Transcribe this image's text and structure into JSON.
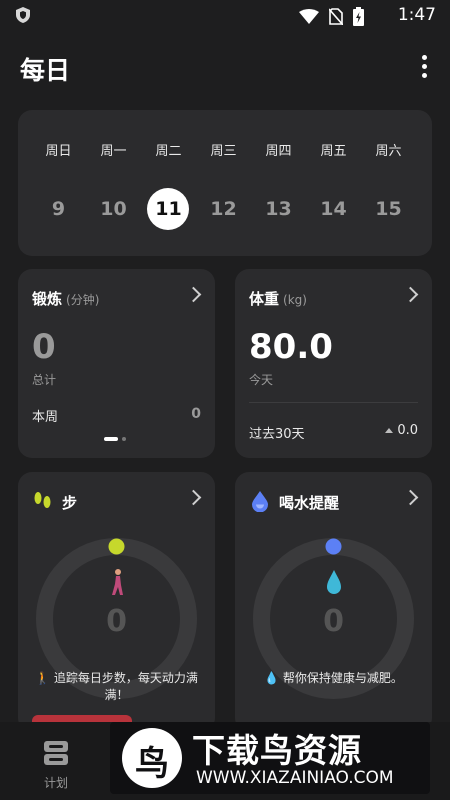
{
  "status_bar": {
    "time": "1:47"
  },
  "app": {
    "title": "每日"
  },
  "week": {
    "names": [
      "周日",
      "周一",
      "周二",
      "周三",
      "周四",
      "周五",
      "周六"
    ],
    "days": [
      "9",
      "10",
      "11",
      "12",
      "13",
      "14",
      "15"
    ],
    "selected_index": 2
  },
  "exercise": {
    "title": "锻炼",
    "unit": "(分钟)",
    "value": "0",
    "sub_label": "总计",
    "week_label": "本周",
    "week_value": "0"
  },
  "weight": {
    "title": "体重",
    "unit": "(kg)",
    "value": "80.0",
    "sub_label": "今天",
    "period_label": "过去30天",
    "change": "0.0"
  },
  "steps": {
    "title": "步",
    "value": "0",
    "tip": "🚶 追踪每日步数，每天动力满满！",
    "dot_color": "#c6d82c"
  },
  "water": {
    "title": "喝水提醒",
    "value": "0",
    "tip": "💧 帮你保持健康与减肥。",
    "dot_color": "#5c80f5"
  },
  "bottom_nav": {
    "plan_label": "计划"
  },
  "watermark": {
    "title": "下载鸟资源",
    "url": "WWW.XIAZAINIAO.COM",
    "logo_char": "鸟"
  }
}
